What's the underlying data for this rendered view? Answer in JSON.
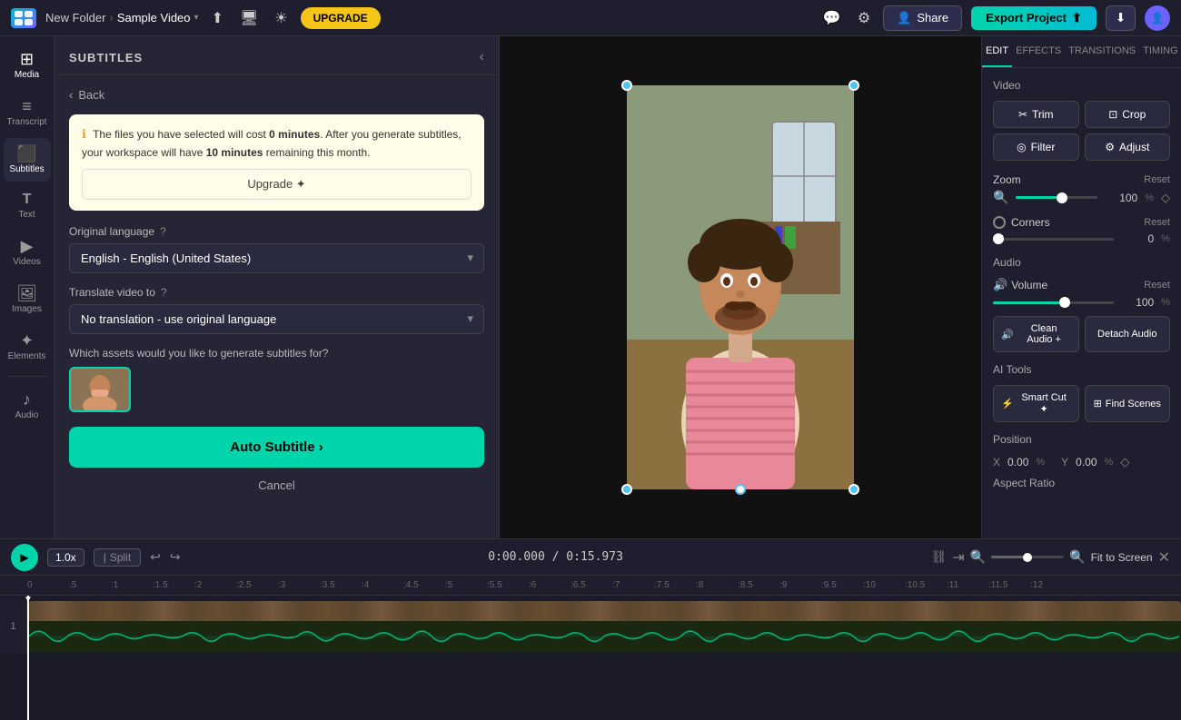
{
  "topbar": {
    "logo_text": "C",
    "folder_name": "New Folder",
    "breadcrumb_sep": "›",
    "video_name": "Sample Video",
    "chevron": "▾",
    "upgrade_label": "UPGRADE",
    "share_label": "Share",
    "export_label": "Export Project",
    "download_icon": "⬇",
    "settings_icon": "⚙",
    "comment_icon": "💬",
    "sun_icon": "☀"
  },
  "sidebar": {
    "items": [
      {
        "id": "media",
        "icon": "⊞",
        "label": "Media"
      },
      {
        "id": "transcript",
        "icon": "≡",
        "label": "Transcript"
      },
      {
        "id": "subtitles",
        "icon": "⬛",
        "label": "Subtitles",
        "active": true
      },
      {
        "id": "text",
        "icon": "T",
        "label": "Text"
      },
      {
        "id": "videos",
        "icon": "▶",
        "label": "Videos"
      },
      {
        "id": "images",
        "icon": "🖼",
        "label": "Images"
      },
      {
        "id": "elements",
        "icon": "✦",
        "label": "Elements"
      },
      {
        "id": "audio",
        "icon": "♪",
        "label": "Audio"
      }
    ]
  },
  "subtitles_panel": {
    "title": "SUBTITLES",
    "back_label": "Back",
    "info_message_prefix": "The files you have selected will cost ",
    "info_cost": "0",
    "info_minutes_label": "minutes",
    "info_message_mid": ". After you generate subtitles, your workspace will have ",
    "info_remaining": "10",
    "info_message_suffix": " minutes remaining this month.",
    "upgrade_btn_label": "Upgrade ✦",
    "original_language_label": "Original language",
    "original_language_help": "?",
    "language_selected": "English - English (United States)",
    "translate_label": "Translate video to",
    "translate_help": "?",
    "translate_selected": "No translation - use original language",
    "assets_label": "Which assets would you like to generate subtitles for?",
    "auto_subtitle_label": "Auto Subtitle ›",
    "cancel_label": "Cancel"
  },
  "right_panel": {
    "tabs": [
      {
        "id": "edit",
        "label": "EDIT",
        "active": true
      },
      {
        "id": "effects",
        "label": "EFFECTS"
      },
      {
        "id": "transitions",
        "label": "TRANSITIONS"
      },
      {
        "id": "timing",
        "label": "TIMING"
      }
    ],
    "video_section": "Video",
    "trim_label": "Trim",
    "crop_label": "Crop",
    "filter_label": "Filter",
    "adjust_label": "Adjust",
    "zoom_label": "Zoom",
    "zoom_reset": "Reset",
    "zoom_value": "100",
    "zoom_unit": "%",
    "zoom_pct": 100,
    "corners_label": "Corners",
    "corners_reset": "Reset",
    "corners_value": "0",
    "corners_unit": "%",
    "corners_pct": 0,
    "audio_section": "Audio",
    "volume_label": "Volume",
    "volume_reset": "Reset",
    "volume_value": "100",
    "volume_unit": "%",
    "volume_pct": 100,
    "clean_audio_label": "Clean Audio +",
    "detach_audio_label": "Detach Audio",
    "ai_tools_section": "AI Tools",
    "smart_cut_label": "Smart Cut ✦",
    "find_scenes_label": "Find Scenes",
    "position_section": "Position",
    "pos_x_label": "X",
    "pos_x_value": "0.00",
    "pos_x_unit": "%",
    "pos_y_label": "Y",
    "pos_y_value": "0.00",
    "pos_y_unit": "%",
    "aspect_ratio_section": "Aspect Ratio"
  },
  "timeline": {
    "play_icon": "▶",
    "speed_label": "1.0x",
    "split_label": "Split",
    "undo_icon": "↩",
    "redo_icon": "↪",
    "time_current": "0:00.000",
    "time_total": "0:15.973",
    "time_separator": "/",
    "fit_screen_label": "Fit to Screen",
    "ruler_marks": [
      "0",
      ".5",
      ":1",
      ":1.5",
      ":2",
      ":2.5",
      ":3",
      ":3.5",
      ":4",
      ":4.5",
      ":5",
      ":5.5",
      ":6",
      ":6.5",
      ":7",
      ":7.5",
      ":8",
      ":8.5",
      ":9",
      ":9.5",
      ":10",
      ":10.5",
      ":11",
      ":11.5",
      ":12"
    ],
    "track_number": "1"
  }
}
